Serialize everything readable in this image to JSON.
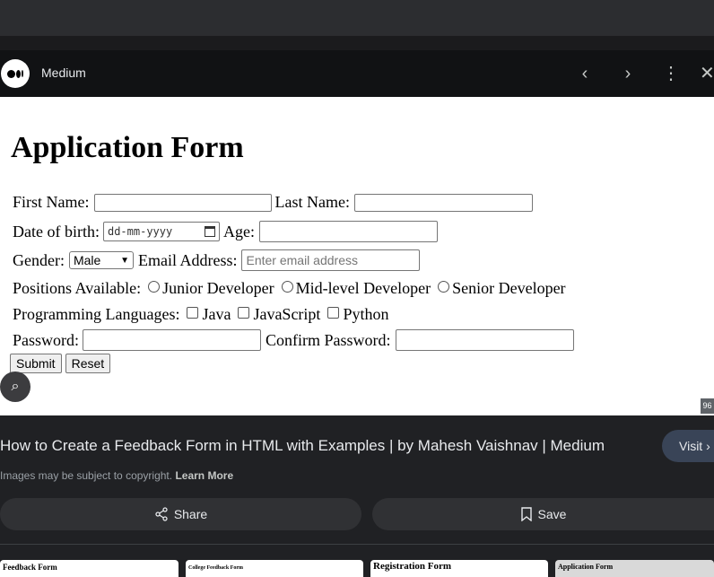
{
  "header": {
    "site_name": "Medium"
  },
  "preview": {
    "form_title": "Application Form",
    "first_name_label": "First Name:",
    "last_name_label": "Last Name:",
    "dob_label": "Date of birth:",
    "dob_placeholder": "dd-mm-yyyy",
    "age_label": "Age:",
    "gender_label": "Gender:",
    "gender_value": "Male",
    "email_label": "Email Address:",
    "email_placeholder": "Enter email address",
    "positions_label": "Positions Available:",
    "positions": [
      "Junior Developer",
      "Mid-level Developer",
      "Senior Developer"
    ],
    "languages_label": "Programming Languages:",
    "languages": [
      "Java",
      "JavaScript",
      "Python"
    ],
    "password_label": "Password:",
    "confirm_password_label": "Confirm Password:",
    "submit_label": "Submit",
    "reset_label": "Reset",
    "corner_badge": "96"
  },
  "result": {
    "title": "How to Create a Feedback Form in HTML with Examples | by Mahesh Vaishnav | Medium",
    "visit_label": "Visit",
    "copyright_text": "Images may be subject to copyright.",
    "learn_more": "Learn More",
    "share_label": "Share",
    "save_label": "Save"
  },
  "related_thumbnails": [
    "Feedback Form",
    "College Feedback Form",
    "Registration Form",
    "Application Form"
  ]
}
